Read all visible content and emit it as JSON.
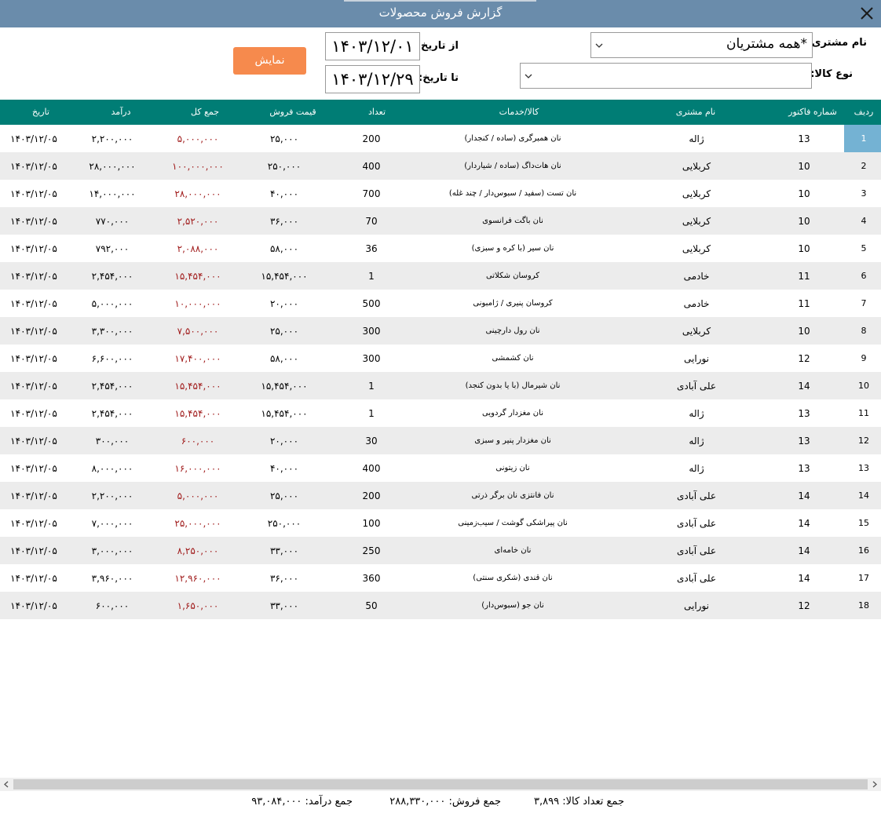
{
  "window": {
    "title": "گزارش فروش محصولات",
    "close_icon": "close-icon"
  },
  "filters": {
    "customer_label": "نام مشتری:",
    "customer_value": "*همه مشتریان",
    "product_type_label": "نوع کالا:",
    "product_type_value": "",
    "from_label": "از تاریخ:",
    "from_value": "۱۴۰۳/۱۲/۰۱",
    "to_label": "تا تاریخ:",
    "to_value": "۱۴۰۳/۱۲/۲۹",
    "show_button": "نمایش"
  },
  "colors": {
    "title_bar": "#6a8cab",
    "header": "#007d75",
    "button": "#f68a4d",
    "total": "#a11d1d",
    "selected": "#74b2d3"
  },
  "table": {
    "columns": {
      "row": "ردیف",
      "invoice": "شماره فاکتور",
      "customer": "نام مشتری",
      "product": "کالا/خدمات",
      "qty": "تعداد",
      "price": "قیمت فروش",
      "total": "جمع کل",
      "income": "درآمد",
      "date": "تاریخ"
    },
    "rows": [
      {
        "row": "1",
        "invoice": "13",
        "customer": "ژاله",
        "product": "نان همبرگری (ساده / کنجدار)",
        "qty": "200",
        "price": "۲۵,۰۰۰",
        "total": "۵,۰۰۰,۰۰۰",
        "income": "۲,۲۰۰,۰۰۰",
        "date": "۱۴۰۳/۱۲/۰۵"
      },
      {
        "row": "2",
        "invoice": "10",
        "customer": "کربلایی",
        "product": "نان هات‌داگ (ساده / شیاردار)",
        "qty": "400",
        "price": "۲۵۰,۰۰۰",
        "total": "۱۰۰,۰۰۰,۰۰۰",
        "income": "۲۸,۰۰۰,۰۰۰",
        "date": "۱۴۰۳/۱۲/۰۵"
      },
      {
        "row": "3",
        "invoice": "10",
        "customer": "کربلایی",
        "product": "نان تست (سفید / سبوس‌دار / چند غله)",
        "qty": "700",
        "price": "۴۰,۰۰۰",
        "total": "۲۸,۰۰۰,۰۰۰",
        "income": "۱۴,۰۰۰,۰۰۰",
        "date": "۱۴۰۳/۱۲/۰۵"
      },
      {
        "row": "4",
        "invoice": "10",
        "customer": "کربلایی",
        "product": "نان باگت فرانسوی",
        "qty": "70",
        "price": "۳۶,۰۰۰",
        "total": "۲,۵۲۰,۰۰۰",
        "income": "۷۷۰,۰۰۰",
        "date": "۱۴۰۳/۱۲/۰۵"
      },
      {
        "row": "5",
        "invoice": "10",
        "customer": "کربلایی",
        "product": "نان سیر (با کره و سبزی)",
        "qty": "36",
        "price": "۵۸,۰۰۰",
        "total": "۲,۰۸۸,۰۰۰",
        "income": "۷۹۲,۰۰۰",
        "date": "۱۴۰۳/۱۲/۰۵"
      },
      {
        "row": "6",
        "invoice": "11",
        "customer": "خادمی",
        "product": "کروسان شکلاتی",
        "qty": "1",
        "price": "۱۵,۴۵۴,۰۰۰",
        "total": "۱۵,۴۵۴,۰۰۰",
        "income": "۲,۴۵۴,۰۰۰",
        "date": "۱۴۰۳/۱۲/۰۵"
      },
      {
        "row": "7",
        "invoice": "11",
        "customer": "خادمی",
        "product": "کروسان پنیری / ژامبونی",
        "qty": "500",
        "price": "۲۰,۰۰۰",
        "total": "۱۰,۰۰۰,۰۰۰",
        "income": "۵,۰۰۰,۰۰۰",
        "date": "۱۴۰۳/۱۲/۰۵"
      },
      {
        "row": "8",
        "invoice": "10",
        "customer": "کربلایی",
        "product": "نان رول دارچینی",
        "qty": "300",
        "price": "۲۵,۰۰۰",
        "total": "۷,۵۰۰,۰۰۰",
        "income": "۳,۳۰۰,۰۰۰",
        "date": "۱۴۰۳/۱۲/۰۵"
      },
      {
        "row": "9",
        "invoice": "12",
        "customer": "نورایی",
        "product": "نان کشمشی",
        "qty": "300",
        "price": "۵۸,۰۰۰",
        "total": "۱۷,۴۰۰,۰۰۰",
        "income": "۶,۶۰۰,۰۰۰",
        "date": "۱۴۰۳/۱۲/۰۵"
      },
      {
        "row": "10",
        "invoice": "14",
        "customer": "علی آبادی",
        "product": "نان شیرمال (با یا بدون کنجد)",
        "qty": "1",
        "price": "۱۵,۴۵۴,۰۰۰",
        "total": "۱۵,۴۵۴,۰۰۰",
        "income": "۲,۴۵۴,۰۰۰",
        "date": "۱۴۰۳/۱۲/۰۵"
      },
      {
        "row": "11",
        "invoice": "13",
        "customer": "ژاله",
        "product": "نان مغزدار گردویی",
        "qty": "1",
        "price": "۱۵,۴۵۴,۰۰۰",
        "total": "۱۵,۴۵۴,۰۰۰",
        "income": "۲,۴۵۴,۰۰۰",
        "date": "۱۴۰۳/۱۲/۰۵"
      },
      {
        "row": "12",
        "invoice": "13",
        "customer": "ژاله",
        "product": "نان مغزدار پنیر و سبزی",
        "qty": "30",
        "price": "۲۰,۰۰۰",
        "total": "۶۰۰,۰۰۰",
        "income": "۳۰۰,۰۰۰",
        "date": "۱۴۰۳/۱۲/۰۵"
      },
      {
        "row": "13",
        "invoice": "13",
        "customer": "ژاله",
        "product": "نان زیتونی",
        "qty": "400",
        "price": "۴۰,۰۰۰",
        "total": "۱۶,۰۰۰,۰۰۰",
        "income": "۸,۰۰۰,۰۰۰",
        "date": "۱۴۰۳/۱۲/۰۵"
      },
      {
        "row": "14",
        "invoice": "14",
        "customer": "علی آبادی",
        "product": "نان فانتزی نان برگر ذرتی",
        "qty": "200",
        "price": "۲۵,۰۰۰",
        "total": "۵,۰۰۰,۰۰۰",
        "income": "۲,۲۰۰,۰۰۰",
        "date": "۱۴۰۳/۱۲/۰۵"
      },
      {
        "row": "15",
        "invoice": "14",
        "customer": "علی آبادی",
        "product": "نان پیراشکی گوشت / سیب‌زمینی",
        "qty": "100",
        "price": "۲۵۰,۰۰۰",
        "total": "۲۵,۰۰۰,۰۰۰",
        "income": "۷,۰۰۰,۰۰۰",
        "date": "۱۴۰۳/۱۲/۰۵"
      },
      {
        "row": "16",
        "invoice": "14",
        "customer": "علی آبادی",
        "product": "نان خامه‌ای",
        "qty": "250",
        "price": "۳۳,۰۰۰",
        "total": "۸,۲۵۰,۰۰۰",
        "income": "۳,۰۰۰,۰۰۰",
        "date": "۱۴۰۳/۱۲/۰۵"
      },
      {
        "row": "17",
        "invoice": "14",
        "customer": "علی آبادی",
        "product": "نان قندی (شکری سنتی)",
        "qty": "360",
        "price": "۳۶,۰۰۰",
        "total": "۱۲,۹۶۰,۰۰۰",
        "income": "۳,۹۶۰,۰۰۰",
        "date": "۱۴۰۳/۱۲/۰۵"
      },
      {
        "row": "18",
        "invoice": "12",
        "customer": "نورایی",
        "product": "نان جو (سبوس‌دار)",
        "qty": "50",
        "price": "۳۳,۰۰۰",
        "total": "۱,۶۵۰,۰۰۰",
        "income": "۶۰۰,۰۰۰",
        "date": "۱۴۰۳/۱۲/۰۵"
      }
    ]
  },
  "summary": {
    "qty_total": "جمع تعداد کالا: ۳,۸۹۹",
    "sales_total": "جمع فروش: ۲۸۸,۳۳۰,۰۰۰",
    "income_total": "جمع درآمد: ۹۳,۰۸۴,۰۰۰"
  }
}
